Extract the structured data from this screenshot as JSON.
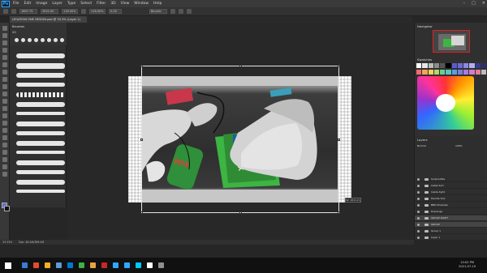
{
  "menubar": {
    "logo": "Ps",
    "items": [
      "File",
      "Edit",
      "Image",
      "Layer",
      "Type",
      "Select",
      "Filter",
      "3D",
      "View",
      "Window",
      "Help"
    ],
    "window_controls": [
      "–",
      "□",
      "✕"
    ]
  },
  "options_bar": {
    "x_value": "1697.75",
    "y_value": "3022.00",
    "w_value": "118.00%",
    "h_value": "118.00%",
    "angle": "0.00",
    "interpolation": "Bicubic"
  },
  "document_tab": {
    "label": "LEGATION ONE DESIGN.psd @ 33.3% (Layer 1)"
  },
  "brush_panel": {
    "title": "Brushes",
    "size_value": "20"
  },
  "canvas": {
    "size_tooltip": "W: 18.9 cm"
  },
  "navigator": {
    "title": "Navigator"
  },
  "swatches": {
    "title": "Swatches",
    "colors": [
      "#ffffff",
      "#e6e6e6",
      "#bdbdbd",
      "#8c8c8c",
      "#555555",
      "#000000",
      "#5a5ad2",
      "#6b6bd6",
      "#8a8ae0",
      "#b0b0ef",
      "#3a3a8c",
      "#2d2d6e",
      "#f26d6d",
      "#f5a25d",
      "#f7d15a",
      "#b4d66b",
      "#6bcf8f",
      "#5dc4c4",
      "#5c9fe0",
      "#7d7de0",
      "#a77de0",
      "#d67dc4",
      "#e07d9a",
      "#bdbdbd"
    ]
  },
  "layers_panel": {
    "title": "Layers",
    "blend_mode": "Normal",
    "opacity": "100%",
    "rows": [
      {
        "name": "Soda bottle",
        "selected": false
      },
      {
        "name": "Cable Sort",
        "selected": false
      },
      {
        "name": "Inside tight",
        "selected": false
      },
      {
        "name": "Handle Tool",
        "selected": false
      },
      {
        "name": "BBQ Shadows",
        "selected": false
      },
      {
        "name": "Drawings",
        "selected": false
      },
      {
        "name": "GROUP RIGHT",
        "selected": true
      },
      {
        "name": "GROUP",
        "selected": true
      },
      {
        "name": "Group 1",
        "selected": false
      },
      {
        "name": "Layer 1",
        "selected": false
      }
    ]
  },
  "status_bar": {
    "zoom": "33.33%",
    "doc_info": "Doc: 48.4M/389.4M"
  },
  "taskbar": {
    "time": "10:02 PM",
    "date": "2021-07-19",
    "icon_colors": [
      "#3a7bd5",
      "#e04d2e",
      "#f2b02a",
      "#5a9bd8",
      "#0078d4",
      "#3db04a",
      "#e8a33d",
      "#c62828",
      "#31a8ff",
      "#31a8ff",
      "#00c8ff",
      "#ffffff",
      "#8f8f8f"
    ]
  }
}
